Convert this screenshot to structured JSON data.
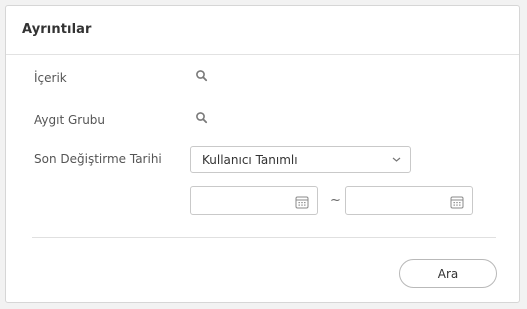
{
  "panel": {
    "title": "Ayrıntılar"
  },
  "fields": {
    "content": {
      "label": "İçerik",
      "icon": "search-icon"
    },
    "device_group": {
      "label": "Aygıt Grubu",
      "icon": "search-icon"
    },
    "last_modified": {
      "label": "Son Değiştirme Tarihi",
      "selected": "Kullanıcı Tanımlı",
      "start_date": "",
      "end_date": "",
      "range_separator": "~",
      "icon": "calendar-icon"
    }
  },
  "actions": {
    "search_label": "Ara"
  }
}
